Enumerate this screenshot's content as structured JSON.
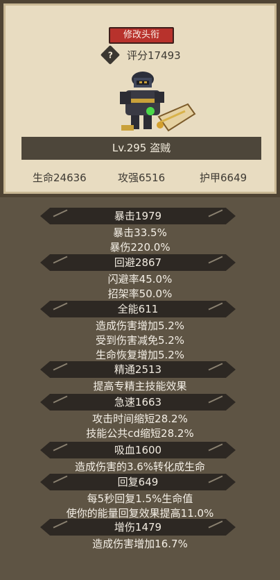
{
  "header": {
    "title_button": "修改头衔",
    "rating_icon": "question-mark-icon",
    "rating_text": "评分17493",
    "character_name": "Lv.295 盗贼",
    "stats": [
      {
        "label": "生命24636"
      },
      {
        "label": "攻强6516"
      },
      {
        "label": "护甲6649"
      }
    ]
  },
  "attributes": [
    {
      "title": "暴击1979",
      "lines": [
        "暴击33.5%",
        "暴伤220.0%"
      ]
    },
    {
      "title": "回避2867",
      "lines": [
        "闪避率45.0%",
        "招架率50.0%"
      ]
    },
    {
      "title": "全能611",
      "lines": [
        "造成伤害增加5.2%",
        "受到伤害减免5.2%",
        "生命恢复增加5.2%"
      ]
    },
    {
      "title": "精通2513",
      "lines": [
        "提高专精主技能效果"
      ]
    },
    {
      "title": "急速1663",
      "lines": [
        "攻击时间缩短28.2%",
        "技能公共cd缩短28.2%"
      ]
    },
    {
      "title": "吸血1600",
      "lines": [
        "造成伤害的3.6%转化成生命"
      ]
    },
    {
      "title": "回复649",
      "lines": [
        "每5秒回复1.5%生命值",
        "使你的能量回复效果提高11.0%"
      ]
    },
    {
      "title": "增伤1479",
      "lines": [
        "造成伤害增加16.7%"
      ]
    }
  ]
}
